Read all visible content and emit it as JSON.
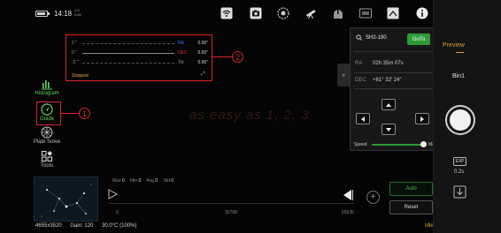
{
  "status": {
    "time": "14:18",
    "net_top": "1.9",
    "net_bottom": "0.84",
    "icons": [
      "wifi-icon",
      "camera-icon",
      "focuser-icon",
      "telescope-icon",
      "observatory-icon",
      "preset-icon",
      "guide-scope-icon",
      "info-icon"
    ]
  },
  "histogram_panel": {
    "rows": [
      {
        "axis": "2 ″",
        "label": "RA",
        "value": "0.00″",
        "color": "#3d7bff"
      },
      {
        "axis": "0 ″",
        "label": "DEC",
        "value": "0.00″",
        "color": "#e03434"
      },
      {
        "axis": "-2 ″",
        "label": "Tot",
        "value": "0.00″",
        "color": "#9a9a9a"
      }
    ],
    "state": "Stopped",
    "callout": "2"
  },
  "left_tools": [
    {
      "label": "Histogram",
      "icon": "histogram-icon",
      "active": true
    },
    {
      "label": "Guide",
      "icon": "guide-icon",
      "active": true
    },
    {
      "label": "Plate Solve",
      "icon": "plate-solve-icon",
      "active": false
    },
    {
      "label": "Tools",
      "icon": "tools-icon",
      "active": false
    }
  ],
  "guide_callout": "1",
  "watermark": "as easy as 1, 2, 3",
  "stats": {
    "max_label": "Max",
    "max": "0",
    "min_label": "Min",
    "min": "0",
    "avg_label": "Avg",
    "avg": "0",
    "std_label": "Std",
    "std": "0"
  },
  "hist_ticks": [
    "0",
    "32768",
    "65535"
  ],
  "buttons": {
    "auto": "Auto",
    "reset": "Reset"
  },
  "footer": {
    "resolution": "4655x3520",
    "gain": "Gain: 120",
    "temp": "30.0°C (100%)",
    "state": "Idle"
  },
  "goto_panel": {
    "search_value": "SH2-190",
    "goto_label": "GoTo",
    "ra_label": "RA",
    "ra": "02h 35m 07s",
    "dec_label": "DEC",
    "dec": "+61° 32′ 24″",
    "speed_label": "Speed",
    "speed_max": "Max",
    "speed_level": 0.95
  },
  "right_bar": {
    "preview": "Preview",
    "bin": "Bin1",
    "exp_badge": "EXP",
    "exposure": "0.2s"
  },
  "colors": {
    "accent_green": "#2e9b3a",
    "accent_orange": "#e0a23c",
    "annotation_red": "#d8232a"
  }
}
